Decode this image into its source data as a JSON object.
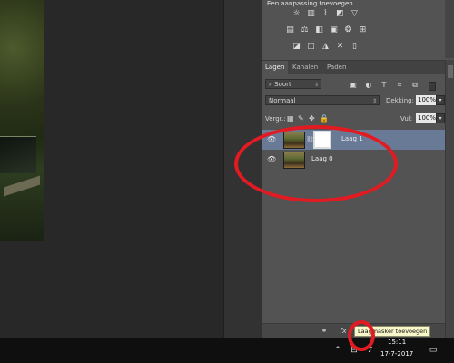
{
  "adjustments": {
    "title": "Een aanpassing toevoegen",
    "row1_icons": [
      "brightness-icon",
      "levels-icon",
      "curves-icon",
      "exposure-icon",
      "vibrance-triangle-icon"
    ],
    "row2_icons": [
      "hue-saturation-icon",
      "color-balance-icon",
      "black-white-icon",
      "photo-filter-icon",
      "channel-mixer-icon",
      "color-lookup-icon"
    ],
    "row3_icons": [
      "invert-icon",
      "posterize-icon",
      "threshold-icon",
      "selective-color-icon",
      "gradient-map-icon"
    ]
  },
  "layers_panel": {
    "tabs": [
      {
        "label": "Lagen",
        "active": true
      },
      {
        "label": "Kanalen",
        "active": false
      },
      {
        "label": "Paden",
        "active": false
      }
    ],
    "filter": {
      "label": "Soort",
      "icons": [
        "image-filter-icon",
        "adjustment-filter-icon",
        "type-filter-icon",
        "shape-filter-icon",
        "smart-object-filter-icon"
      ]
    },
    "blend_mode": "Normaal",
    "opacity_label": "Dekking:",
    "opacity_value": "100%",
    "lock_label": "Vergr.:",
    "fill_label": "Vul:",
    "fill_value": "100%",
    "layers": [
      {
        "name": "Laag 1",
        "selected": true,
        "has_mask": true
      },
      {
        "name": "Laag 0",
        "selected": false,
        "has_mask": false
      }
    ],
    "bottom_icons": [
      "link-icon",
      "fx-icon",
      "add-mask-icon"
    ]
  },
  "tooltip": "Laagmasker toevoegen",
  "taskbar": {
    "time": "15:11",
    "date": "17-7-2017"
  },
  "annotation_color": "#e21b23"
}
